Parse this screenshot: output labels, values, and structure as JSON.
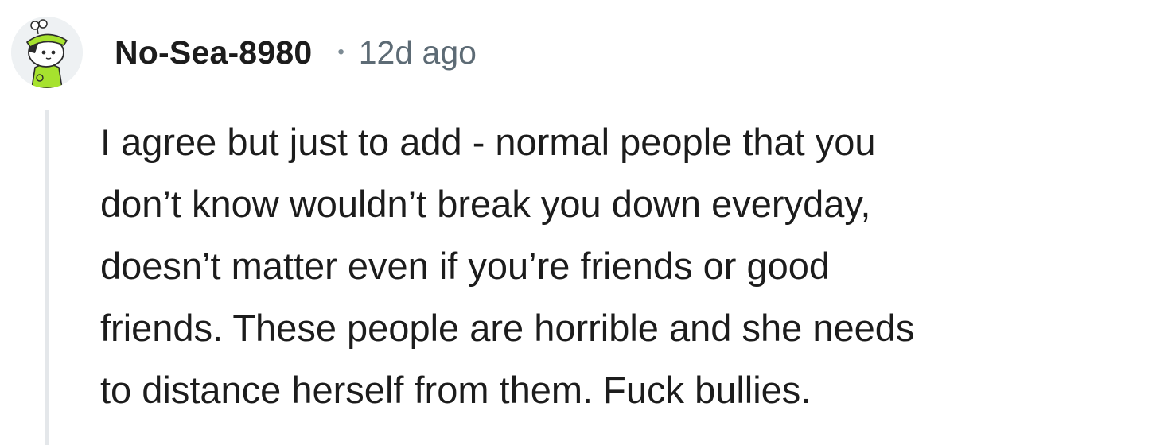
{
  "comment": {
    "author": "No-Sea-8980",
    "separator": "•",
    "timestamp": "12d ago",
    "body": "I agree but just to add - normal people that you\ndon’t know wouldn’t break you down everyday,\ndoesn’t matter even if you’re friends or good\nfriends. These people are horrible and she needs\nto distance herself from them. Fuck bullies.",
    "avatar": {
      "icon": "snoo-avatar-icon",
      "hat_color": "#a6e22e",
      "shirt_color": "#a6e22e"
    }
  }
}
